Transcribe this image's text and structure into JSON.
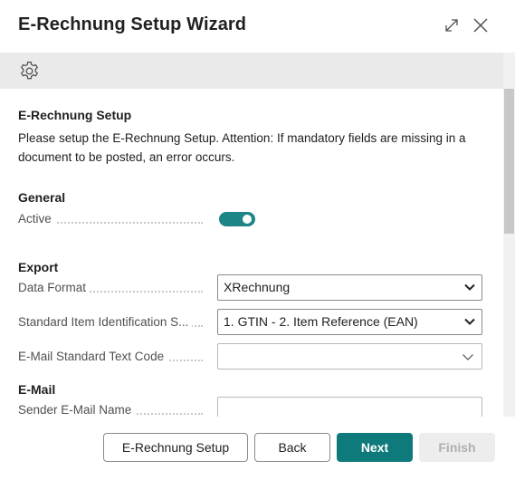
{
  "dialog": {
    "title": "E-Rechnung Setup Wizard"
  },
  "intro": {
    "heading": "E-Rechnung Setup",
    "description": "Please setup the E-Rechnung Setup. Attention: If mandatory fields are missing in a document to be posted, an error occurs."
  },
  "general": {
    "heading": "General",
    "active_label": "Active",
    "active_value": true
  },
  "export": {
    "heading": "Export",
    "data_format_label": "Data Format",
    "data_format_value": "XRechnung",
    "item_id_label": "Standard Item Identification S...",
    "item_id_value": "1. GTIN - 2. Item Reference (EAN)",
    "email_text_code_label": "E-Mail Standard Text Code",
    "email_text_code_value": ""
  },
  "email": {
    "heading": "E-Mail",
    "sender_name_label": "Sender E-Mail Name",
    "sender_name_value": ""
  },
  "footer": {
    "setup_label": "E-Rechnung Setup",
    "back_label": "Back",
    "next_label": "Next",
    "finish_label": "Finish"
  },
  "colors": {
    "accent": "#0f7a7c",
    "toggle_on": "#1d8585",
    "action_bar": "#eaeaea"
  },
  "icons": {
    "expand": "expand-icon",
    "close": "close-icon",
    "settings": "gear-icon",
    "dropdown": "chevron-down-icon"
  }
}
